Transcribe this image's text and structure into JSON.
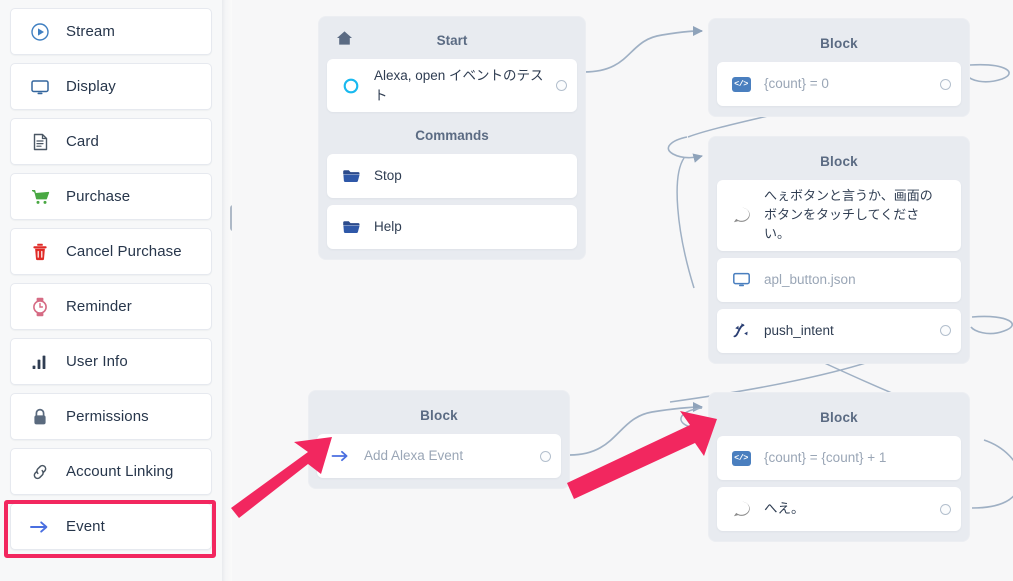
{
  "sidebar": {
    "items": [
      {
        "label": "Stream",
        "icon": "play-circle-icon"
      },
      {
        "label": "Display",
        "icon": "monitor-icon"
      },
      {
        "label": "Card",
        "icon": "document-icon"
      },
      {
        "label": "Purchase",
        "icon": "shopping-cart-icon"
      },
      {
        "label": "Cancel Purchase",
        "icon": "trash-icon"
      },
      {
        "label": "Reminder",
        "icon": "watch-icon"
      },
      {
        "label": "User Info",
        "icon": "bar-chart-icon"
      },
      {
        "label": "Permissions",
        "icon": "lock-icon"
      },
      {
        "label": "Account Linking",
        "icon": "link-icon"
      },
      {
        "label": "Event",
        "icon": "arrow-right-icon"
      }
    ],
    "highlighted_item": "Event",
    "highlight_color": "#f2275f"
  },
  "canvas": {
    "blocks": [
      {
        "id": "start",
        "title": "Start",
        "icon": "home-icon",
        "rows": [
          {
            "text": "Alexa, open イベントのテスト",
            "icon": "circle-outline-icon",
            "port": true,
            "muted": false
          }
        ],
        "section_label": "Commands",
        "commands": [
          {
            "text": "Stop",
            "icon": "folder-icon"
          },
          {
            "text": "Help",
            "icon": "folder-icon"
          }
        ]
      },
      {
        "id": "count-zero",
        "title": "Block",
        "rows": [
          {
            "text": "{count} = 0",
            "icon": "code-icon",
            "port": true,
            "muted": true
          }
        ]
      },
      {
        "id": "apl-block",
        "title": "Block",
        "rows": [
          {
            "text": "へぇボタンと言うか、画面のボタンをタッチしてください。",
            "icon": "speech-bubble-icon",
            "port": false,
            "muted": false
          },
          {
            "text": "apl_button.json",
            "icon": "monitor-icon",
            "port": false,
            "muted": true
          },
          {
            "text": "push_intent",
            "icon": "intent-icon",
            "port": true,
            "muted": false
          }
        ]
      },
      {
        "id": "event-block",
        "title": "Block",
        "rows": [
          {
            "text": "Add Alexa Event",
            "icon": "arrow-right-icon",
            "port": true,
            "muted": true
          }
        ]
      },
      {
        "id": "increment-block",
        "title": "Block",
        "rows": [
          {
            "text": "{count} = {count} + 1",
            "icon": "code-icon",
            "port": false,
            "muted": true
          },
          {
            "text": "へえ。",
            "icon": "speech-bubble-icon",
            "port": true,
            "muted": false
          }
        ]
      }
    ]
  },
  "annotations": {
    "arrows": [
      {
        "name": "red-arrow-to-event-block",
        "color": "#f2275f"
      },
      {
        "name": "red-arrow-to-increment-block",
        "color": "#f2275f"
      }
    ]
  },
  "colors": {
    "canvas_bg": "#f7f7f8",
    "sidebar_bg": "#f7f8f9",
    "block_bg": "#e8ebf0",
    "wire": "#9fb0c4",
    "accent_red": "#f2275f",
    "text": "#27364b"
  }
}
